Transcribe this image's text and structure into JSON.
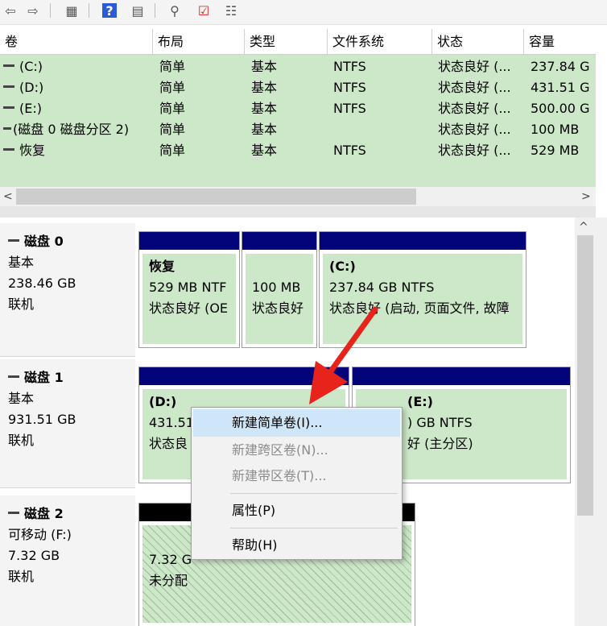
{
  "toolbar": {
    "icons": [
      "back-arrow-icon",
      "forward-arrow-icon",
      "console-tree-icon",
      "help-icon",
      "action-pane-icon",
      "connect-icon",
      "check-icon",
      "list-icon"
    ],
    "glyphs": [
      "⇦",
      "⇨",
      "▦",
      "?",
      "▤",
      "⚲",
      "☑",
      "☷"
    ]
  },
  "columns": [
    "卷",
    "布局",
    "类型",
    "文件系统",
    "状态",
    "容量"
  ],
  "volumes": [
    {
      "name": "(C:)",
      "layout": "简单",
      "type": "基本",
      "fs": "NTFS",
      "status": "状态良好 (...",
      "capacity": "237.84 G"
    },
    {
      "name": "(D:)",
      "layout": "简单",
      "type": "基本",
      "fs": "NTFS",
      "status": "状态良好 (...",
      "capacity": "431.51 G"
    },
    {
      "name": "(E:)",
      "layout": "简单",
      "type": "基本",
      "fs": "NTFS",
      "status": "状态良好 (...",
      "capacity": "500.00 G"
    },
    {
      "name": "(磁盘 0 磁盘分区 2)",
      "layout": "简单",
      "type": "基本",
      "fs": "",
      "status": "状态良好 (...",
      "capacity": "100 MB"
    },
    {
      "name": "恢复",
      "layout": "简单",
      "type": "基本",
      "fs": "NTFS",
      "status": "状态良好 (...",
      "capacity": "529 MB"
    }
  ],
  "scroll": {
    "left": "<",
    "right": ">",
    "up": "^"
  },
  "disks": [
    {
      "name": "磁盘 0",
      "type": "基本",
      "size": "238.46 GB",
      "state": "联机"
    },
    {
      "name": "磁盘 1",
      "type": "基本",
      "size": "931.51 GB",
      "state": "联机"
    },
    {
      "name": "磁盘 2",
      "type": "可移动 (F:)",
      "size": "7.32 GB",
      "state": "联机"
    }
  ],
  "partitions": {
    "d0_recovery": {
      "title": "恢复",
      "line1": "529 MB NTF",
      "line2": "状态良好 (OE"
    },
    "d0_p2": {
      "title": "",
      "line1": "100 MB",
      "line2": "状态良好"
    },
    "d0_c": {
      "title": "(C:)",
      "line1": "237.84 GB NTFS",
      "line2": "状态良好 (启动, 页面文件, 故障"
    },
    "d1_d": {
      "title": "(D:)",
      "line1": "431.51",
      "line2": "状态良"
    },
    "d1_e": {
      "title": "(E:)",
      "line1": ") GB NTFS",
      "line2": "好 (主分区)"
    },
    "d2_f": {
      "title": "",
      "line1": "7.32 G",
      "line2": "未分配"
    }
  },
  "menu": {
    "new_simple": "新建简单卷(I)...",
    "new_spanned": "新建跨区卷(N)...",
    "new_striped": "新建带区卷(T)...",
    "properties": "属性(P)",
    "help": "帮助(H)"
  },
  "colors": {
    "accent": "#03037a",
    "volume_bg": "#cde8c9",
    "arrow": "#e8231b",
    "menu_highlight": "#cfe6f9"
  }
}
